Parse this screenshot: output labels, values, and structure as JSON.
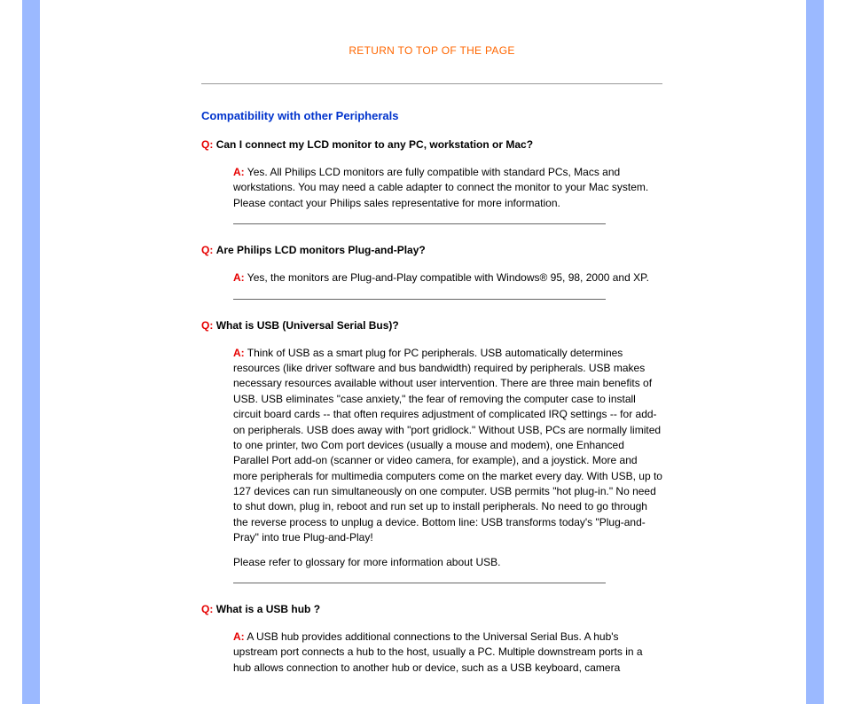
{
  "topLink": "RETURN TO TOP OF THE PAGE",
  "sectionHeading": "Compatibility with other Peripherals",
  "qLabel": "Q:",
  "aLabel": "A:",
  "qa": [
    {
      "q": "Can I connect my LCD monitor to any PC, workstation or Mac?",
      "a": "Yes. All Philips LCD monitors are fully compatible with standard PCs, Macs and workstations. You may need a cable adapter to connect the monitor to your Mac system. Please contact your Philips sales representative for more information.",
      "divider": true
    },
    {
      "q": "Are Philips LCD monitors Plug-and-Play?",
      "a": "Yes, the monitors are Plug-and-Play compatible with Windows® 95, 98, 2000 and XP.",
      "divider": true
    },
    {
      "q": "What is USB (Universal Serial Bus)?",
      "a": "Think of USB as a smart plug for PC peripherals. USB automatically determines resources (like driver software and bus bandwidth) required by peripherals. USB makes necessary resources available without user intervention. There are three main benefits of USB. USB eliminates \"case anxiety,\" the fear of removing the computer case to install circuit board cards -- that often requires adjustment of complicated IRQ settings -- for add-on peripherals. USB does away with \"port gridlock.\" Without USB, PCs are normally limited to one printer, two Com port devices (usually a mouse and modem), one Enhanced Parallel Port add-on (scanner or video camera, for example), and a joystick. More and more peripherals for multimedia computers come on the market every day. With USB, up to 127 devices can run simultaneously on one computer. USB permits \"hot plug-in.\" No need to shut down, plug in, reboot and run set up to install peripherals. No need to go through the reverse process to unplug a device. Bottom line: USB transforms today's \"Plug-and-Pray\" into true Plug-and-Play!",
      "extra": "Please refer to glossary for more information about USB.",
      "divider": true
    },
    {
      "q": "What is a USB hub ?",
      "a": "A USB hub provides additional connections to the Universal Serial Bus. A hub's upstream port connects a hub to the host, usually a PC. Multiple downstream ports in a hub allows connection to another hub or device, such as a USB keyboard, camera",
      "divider": false
    }
  ]
}
